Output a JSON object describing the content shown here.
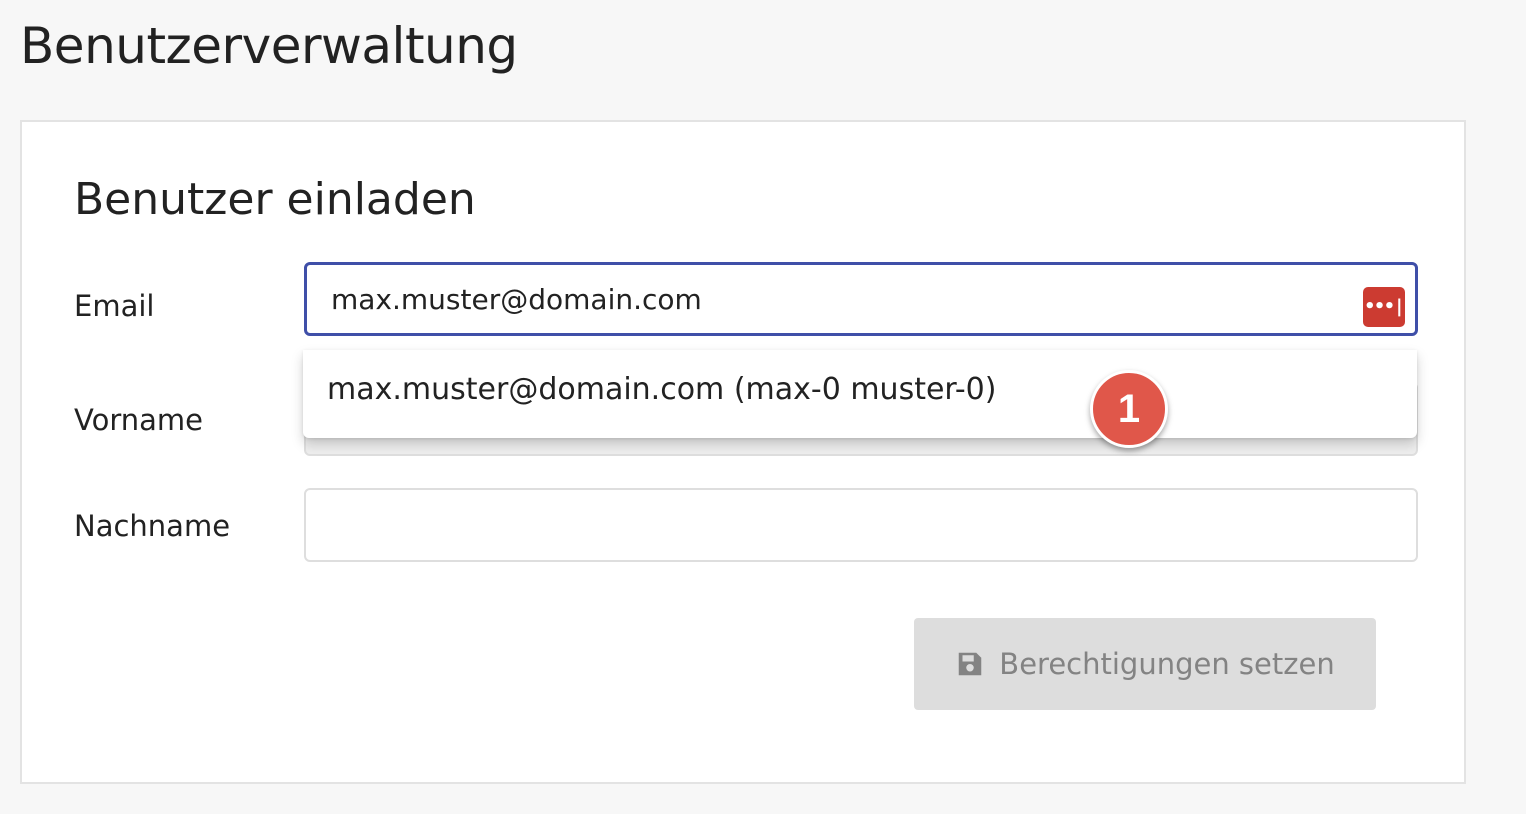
{
  "page": {
    "title": "Benutzerverwaltung"
  },
  "form": {
    "title": "Benutzer einladen",
    "email": {
      "label": "Email",
      "value": "max.muster@domain.com",
      "password_manager_icon": "•••|"
    },
    "vorname": {
      "label": "Vorname",
      "value": ""
    },
    "nachname": {
      "label": "Nachname",
      "value": ""
    },
    "autocomplete": {
      "items": [
        {
          "label": "max.muster@domain.com (max-0 muster-0)"
        }
      ]
    },
    "submit": {
      "label": "Berechtigungen setzen",
      "icon": "floppy-disk-icon",
      "disabled": true
    }
  },
  "annotation": {
    "step_number": "1"
  },
  "colors": {
    "focus_border": "#3f4fa8",
    "password_manager_icon": "#cc3b31",
    "step_badge": "#e0574a",
    "button_disabled_bg": "#dddddd",
    "button_disabled_text": "#838383"
  }
}
